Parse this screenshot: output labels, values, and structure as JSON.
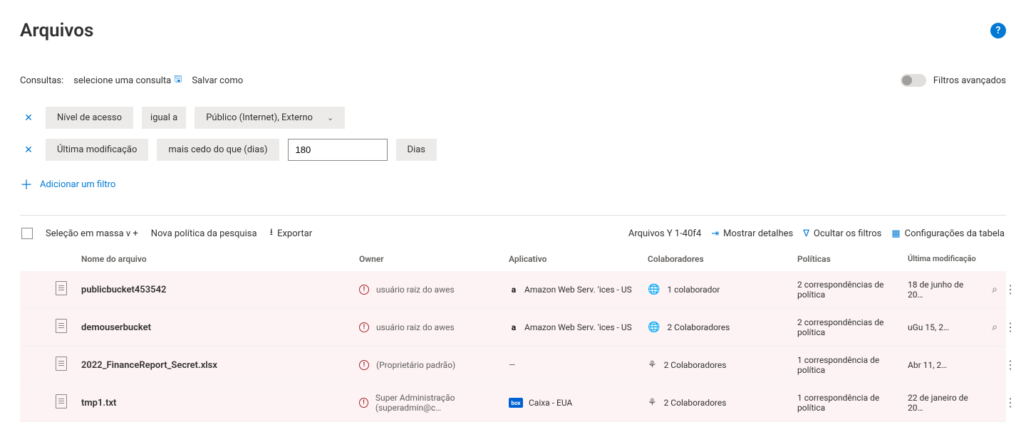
{
  "header": {
    "title": "Arquivos"
  },
  "queries": {
    "label": "Consultas:",
    "select_prompt": "selecione uma consulta",
    "save_as": "Salvar como"
  },
  "advanced_filters": {
    "label": "Filtros avançados",
    "on": false
  },
  "filters": [
    {
      "field": "Nível de acesso",
      "operator": "igual a",
      "value": "Público (Internet), Externo",
      "type": "dropdown"
    },
    {
      "field": "Última modificação",
      "operator": "mais cedo do que (dias)",
      "value": "180",
      "unit": "Dias",
      "type": "number"
    }
  ],
  "add_filter_label": "Adicionar um filtro",
  "toolbar": {
    "bulk_label": "Seleção em massa v +",
    "new_policy": "Nova política da pesquisa",
    "export": "Exportar",
    "counter_prefix": "Arquivos Y 1-40f4",
    "show_details": "Mostrar detalhes",
    "hide_filters": "Ocultar os filtros",
    "table_settings": "Configurações da tabela"
  },
  "columns": {
    "name": "Nome do arquivo",
    "owner": "Owner",
    "app": "Aplicativo",
    "collaborators": "Colaboradores",
    "policies": "Políticas",
    "modified": "Última modificação"
  },
  "rows": [
    {
      "name": "publicbucket453542",
      "owner": "usuário raiz do awes",
      "owner_warn": true,
      "app": "Amazon Web Serv. 'ices -  US",
      "app_icon": "amazon",
      "collab_icon": "globe",
      "collaborators": "1 colaborador",
      "policies": "2 correspondências de política",
      "modified": "18 de junho de 20…",
      "search_action": true
    },
    {
      "name": "demouserbucket",
      "owner": "usuário raiz do awes",
      "owner_warn": true,
      "app": "Amazon Web Serv. 'ices -  US",
      "app_icon": "amazon",
      "collab_icon": "globe",
      "collaborators": "2 Colaboradores",
      "policies": "2 correspondências de política",
      "modified": "uGu 15, 2…",
      "search_action": true
    },
    {
      "name": "2022_FinanceReport_Secret.xlsx",
      "owner": "(Proprietário padrão)",
      "owner_warn": true,
      "app": "—",
      "app_icon": "none",
      "collab_icon": "share",
      "collaborators": "2 Colaboradores",
      "policies": "1 correspondência de política",
      "modified": "Abr 11, 2…",
      "search_action": false
    },
    {
      "name": "tmp1.txt",
      "owner": "Super Administração (superadmin@c…",
      "owner_warn": true,
      "app": "Caixa - EUA",
      "app_icon": "box",
      "collab_icon": "share",
      "collaborators": "2 Colaboradores",
      "policies": "1 correspondência de política",
      "modified": "22 de janeiro de 20…",
      "search_action": false
    }
  ]
}
